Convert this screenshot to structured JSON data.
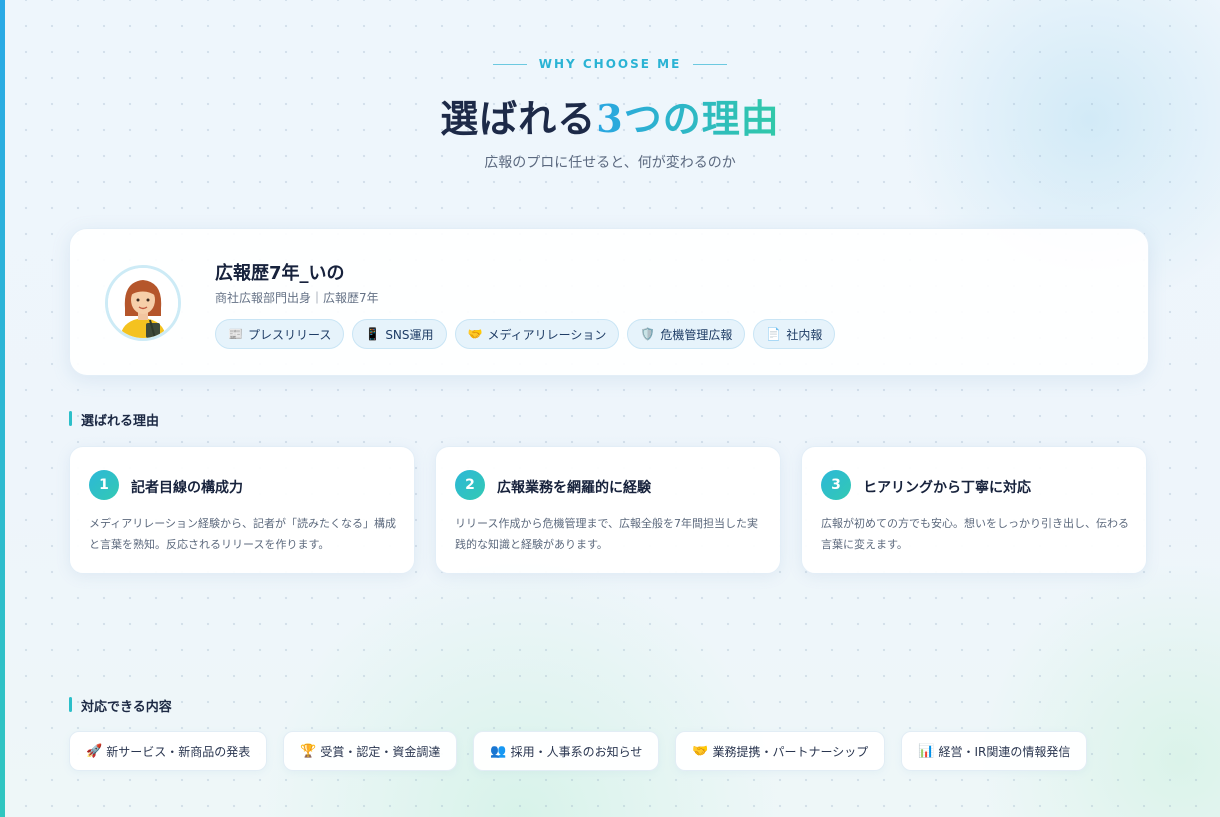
{
  "header": {
    "eyebrow": "WHY CHOOSE ME",
    "title_main": "選ばれる",
    "title_highlight": "3つの理由",
    "subtitle": "広報のプロに任せると、何が変わるのか"
  },
  "profile": {
    "name": "広報歴7年_いの",
    "subtitle": "商社広報部門出身｜広報歴7年",
    "tags": [
      {
        "icon": "📰",
        "icon_name": "newspaper-icon",
        "label": "プレスリリース"
      },
      {
        "icon": "📱",
        "icon_name": "smartphone-icon",
        "label": "SNS運用"
      },
      {
        "icon": "🤝",
        "icon_name": "handshake-icon",
        "label": "メディアリレーション"
      },
      {
        "icon": "🛡️",
        "icon_name": "shield-icon",
        "label": "危機管理広報"
      },
      {
        "icon": "📄",
        "icon_name": "document-icon",
        "label": "社内報"
      }
    ]
  },
  "reasons_section": {
    "label": "選ばれる理由",
    "items": [
      {
        "num": "1",
        "title": "記者目線の構成力",
        "desc": "メディアリレーション経験から、記者が「読みたくなる」構成と言葉を熟知。反応されるリリースを作ります。"
      },
      {
        "num": "2",
        "title": "広報業務を網羅的に経験",
        "desc": "リリース作成から危機管理まで、広報全般を7年間担当した実践的な知識と経験があります。"
      },
      {
        "num": "3",
        "title": "ヒアリングから丁寧に対応",
        "desc": "広報が初めての方でも安心。想いをしっかり引き出し、伝わる言葉に変えます。"
      }
    ]
  },
  "topics_section": {
    "label": "対応できる内容",
    "items": [
      {
        "icon": "🚀",
        "icon_name": "rocket-icon",
        "label": "新サービス・新商品の発表"
      },
      {
        "icon": "🏆",
        "icon_name": "trophy-icon",
        "label": "受賞・認定・資金調達"
      },
      {
        "icon": "👥",
        "icon_name": "people-icon",
        "label": "採用・人事系のお知らせ"
      },
      {
        "icon": "🤝",
        "icon_name": "handshake-icon",
        "label": "業務提携・パートナーシップ"
      },
      {
        "icon": "📊",
        "icon_name": "bar-chart-icon",
        "label": "経営・IR関連の情報発信"
      }
    ]
  },
  "colors": {
    "accent_blue": "#2aa6e2",
    "accent_teal": "#31c9a8",
    "heading": "#1d2a48",
    "tag_bg": "#e6f3fb"
  }
}
